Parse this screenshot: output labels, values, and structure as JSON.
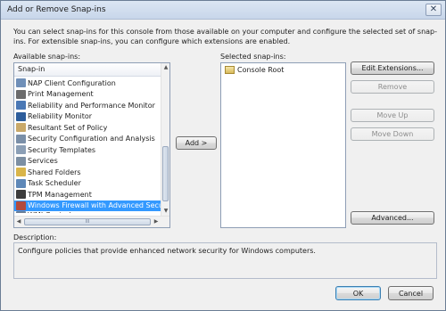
{
  "window": {
    "title": "Add or Remove Snap-ins",
    "close_glyph": "✕"
  },
  "intro_text": "You can select snap-ins for this console from those available on your computer and configure the selected set of snap-ins. For extensible snap-ins, you can configure which extensions are enabled.",
  "available": {
    "label": "Available snap-ins:",
    "column_header": "Snap-in",
    "items": [
      {
        "label": "NAP Client Configuration",
        "icon": "nap-client-icon",
        "color": "#6f8fb8"
      },
      {
        "label": "Print Management",
        "icon": "printer-icon",
        "color": "#6b6b6b"
      },
      {
        "label": "Reliability and Performance Monitor",
        "icon": "performance-monitor-icon",
        "color": "#4a78b5"
      },
      {
        "label": "Reliability Monitor",
        "icon": "reliability-monitor-icon",
        "color": "#2d5d9b"
      },
      {
        "label": "Resultant Set of Policy",
        "icon": "policy-icon",
        "color": "#c9a96a"
      },
      {
        "label": "Security Configuration and Analysis",
        "icon": "security-config-icon",
        "color": "#7a8fa8"
      },
      {
        "label": "Security Templates",
        "icon": "security-templates-icon",
        "color": "#8b9fb6"
      },
      {
        "label": "Services",
        "icon": "services-icon",
        "color": "#7c8fa3"
      },
      {
        "label": "Shared Folders",
        "icon": "shared-folders-icon",
        "color": "#d9b54a"
      },
      {
        "label": "Task Scheduler",
        "icon": "task-scheduler-icon",
        "color": "#5e88b8"
      },
      {
        "label": "TPM Management",
        "icon": "tpm-icon",
        "color": "#3c3c3c"
      },
      {
        "label": "Windows Firewall with Advanced Security",
        "icon": "firewall-icon",
        "color": "#b24a3c"
      },
      {
        "label": "WMI Control",
        "icon": "wmi-icon",
        "color": "#6b7d95"
      }
    ],
    "selected_index": 11,
    "scroll_up": "▲",
    "scroll_down": "▼",
    "scroll_left": "◀",
    "scroll_right": "▶",
    "hthumb_grip": "III"
  },
  "add_button": "Add >",
  "selected": {
    "label": "Selected snap-ins:",
    "items": [
      {
        "label": "Console Root",
        "icon": "console-root-icon"
      }
    ]
  },
  "buttons": {
    "edit_extensions": "Edit Extensions...",
    "remove": "Remove",
    "move_up": "Move Up",
    "move_down": "Move Down",
    "advanced": "Advanced...",
    "ok": "OK",
    "cancel": "Cancel"
  },
  "description": {
    "label": "Description:",
    "text": "Configure policies that provide enhanced network security for Windows computers."
  }
}
